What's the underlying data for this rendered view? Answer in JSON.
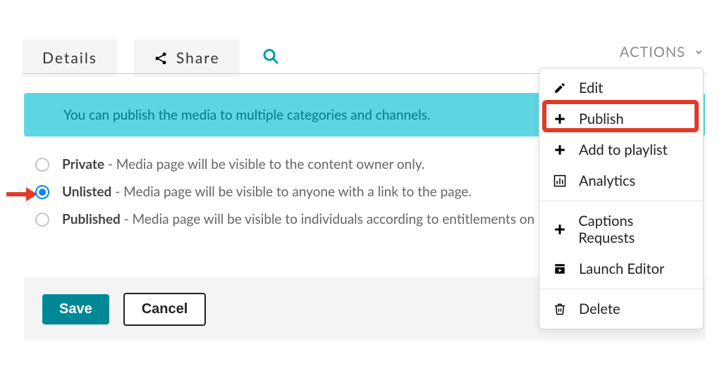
{
  "tabs": {
    "details": "Details",
    "share": "Share"
  },
  "actions_button": "ACTIONS",
  "notice": "You can publish the media to multiple categories and channels.",
  "radios": [
    {
      "title": "Private",
      "desc": " - Media page will be visible to the content owner only."
    },
    {
      "title": "Unlisted",
      "desc": " - Media page will be visible to anyone with a link to the page."
    },
    {
      "title": "Published",
      "desc": " - Media page will be visible to individuals according to entitlements on published destinations."
    }
  ],
  "selected_radio_index": 1,
  "footer": {
    "save": "Save",
    "cancel": "Cancel"
  },
  "actions_menu": {
    "edit": "Edit",
    "publish": "Publish",
    "add_to_playlist": "Add to playlist",
    "analytics": "Analytics",
    "captions": "Captions Requests",
    "launch_editor": "Launch Editor",
    "delete": "Delete"
  },
  "highlighted_menu_item": "publish",
  "colors": {
    "accent_teal": "#008896",
    "notice_bg": "#5ed6e2",
    "notice_text": "#007b8a",
    "highlight_red": "#e03b28",
    "radio_selected": "#0a84ff"
  }
}
